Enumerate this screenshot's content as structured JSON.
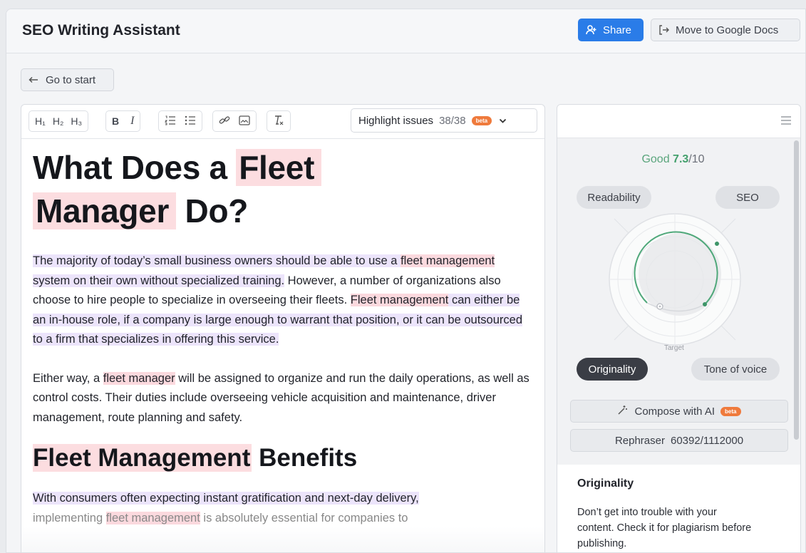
{
  "header": {
    "title": "SEO Writing Assistant",
    "share_label": "Share",
    "gdocs_label": "Move to Google Docs"
  },
  "nav": {
    "go_to_start": "Go to start"
  },
  "toolbar": {
    "h1": "H₁",
    "h2": "H₂",
    "h3": "H₃",
    "bold": "B",
    "italic": "I",
    "highlight_label": "Highlight issues",
    "highlight_count": "38/38",
    "beta": "beta"
  },
  "document": {
    "h1_kw1": "Fleet",
    "h1_kw2": "Manager",
    "h1_pre": "What Does a ",
    "h1_post": " Do?",
    "p1": {
      "s1_a": "The majority of today’s small business owners should be able to use a ",
      "s1_kw": "fleet management",
      "s1_b": " system on their own without specialized training.",
      "s2": " However, a number of organizations also choose to hire people to specialize in overseeing their fleets. ",
      "s3_kw": "Fleet management",
      "s3_b": " can either be an in-house role, if a company is large enough to warrant that position, or it can be outsourced to a firm that specializes in offering this service."
    },
    "p2": {
      "a": "Either way, a ",
      "kw": "fleet manager",
      "b": " will be assigned to organize and run the daily operations, as well as control costs. Their duties include overseeing vehicle acquisition and maintenance, driver management, route planning and safety."
    },
    "h2_kw": "Fleet Management",
    "h2_post": " Benefits",
    "p3": {
      "a": "With consumers often expecting instant gratification and next-day delivery,",
      "b": " implementing ",
      "kw": "fleet management",
      "c": " is absolutely essential for companies to"
    }
  },
  "side": {
    "score_label": "Good",
    "score_value": "7.3",
    "score_max": "/10",
    "tabs": {
      "readability": "Readability",
      "seo": "SEO",
      "originality": "Originality",
      "tone": "Tone of voice"
    },
    "target_label": "Target",
    "compose_label": "Compose with AI",
    "compose_beta": "beta",
    "rephraser_label": "Rephraser",
    "rephraser_count": "60392/1112000",
    "card_title": "Originality",
    "card_text": "Don’t get into trouble with your content. Check it for plagiarism before publishing."
  },
  "colors": {
    "accent": "#2a7ce8",
    "good": "#43a06c",
    "keyword_highlight": "#fbd9de",
    "sentence_highlight": "#ece4fb",
    "beta": "#ef7a3c"
  }
}
